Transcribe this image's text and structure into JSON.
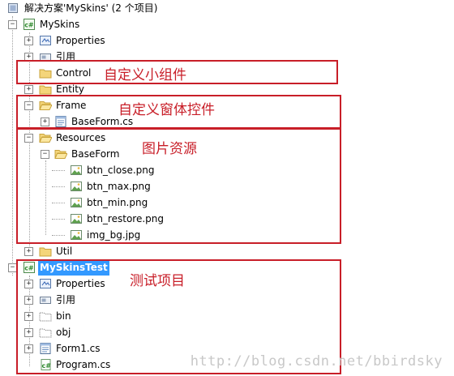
{
  "solution": {
    "label": "解决方案'MySkins' (2 个项目)"
  },
  "project1": {
    "name": "MySkins",
    "items": {
      "properties": "Properties",
      "references": "引用",
      "control": "Control",
      "entity": "Entity",
      "frame": "Frame",
      "baseform_cs": "BaseForm.cs",
      "resources": "Resources",
      "baseform_folder": "BaseForm",
      "files": [
        "btn_close.png",
        "btn_max.png",
        "btn_min.png",
        "btn_restore.png",
        "img_bg.jpg"
      ],
      "util": "Util"
    }
  },
  "project2": {
    "name": "MySkinsTest",
    "items": {
      "properties": "Properties",
      "references": "引用",
      "bin": "bin",
      "obj": "obj",
      "form1": "Form1.cs",
      "program": "Program.cs"
    }
  },
  "annotations": {
    "control": "自定义小组件",
    "frame": "自定义窗体控件",
    "resources": "图片资源",
    "test": "测试项目"
  },
  "watermark": "http://blog.csdn.net/bbirdsky",
  "colors": {
    "annotation": "#c81e28",
    "selection": "#3399ff"
  },
  "icons": {
    "solution": "solution-icon",
    "project": "csharp-project-icon",
    "properties": "properties-icon",
    "references": "references-icon",
    "folder": "folder-icon",
    "open-folder": "open-folder-icon",
    "cs-file": "cs-file-icon",
    "image-file": "image-file-icon"
  }
}
